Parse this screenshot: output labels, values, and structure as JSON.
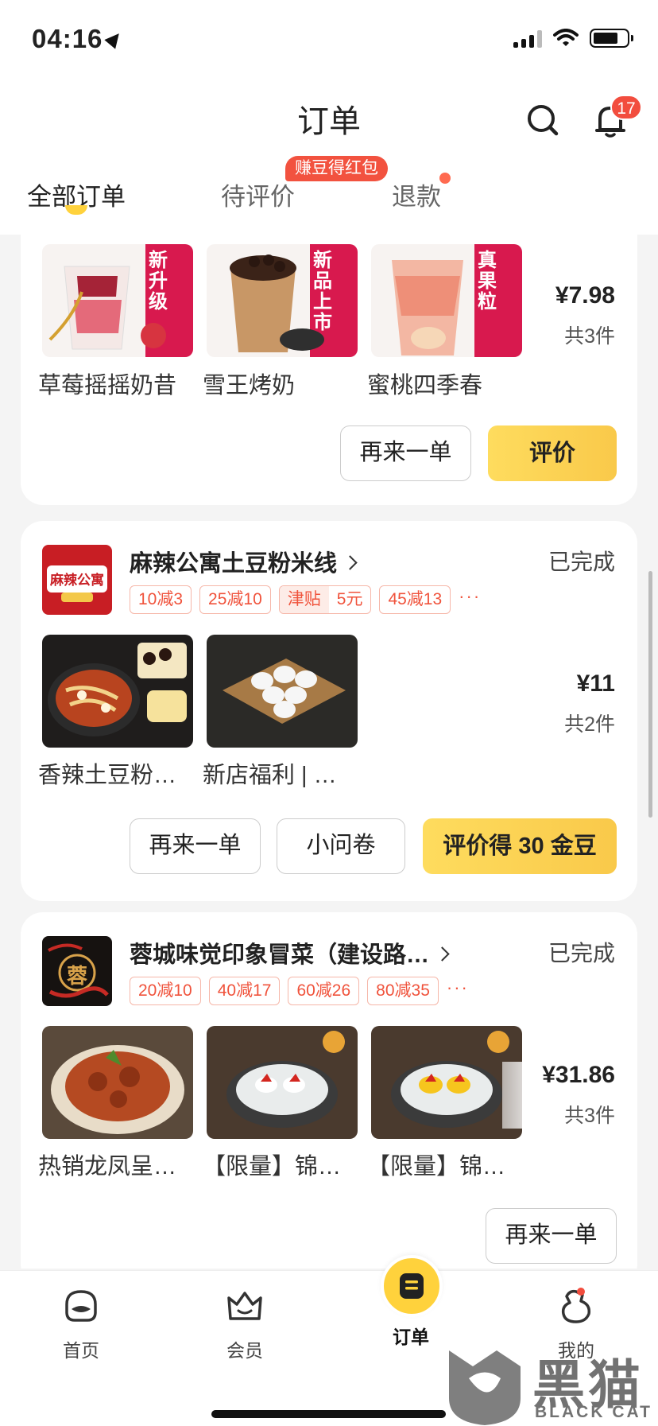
{
  "status_bar": {
    "time": "04:16"
  },
  "header": {
    "title": "订单",
    "notification_count": "17"
  },
  "tabs": [
    {
      "label": "全部订单",
      "active": true
    },
    {
      "label": "待评价",
      "active": false
    },
    {
      "label": "退款",
      "active": false
    }
  ],
  "tab_promo": "赚豆得红包",
  "orders": [
    {
      "items": [
        {
          "name": "草莓摇摇奶昔",
          "icon": "strawberry-milkshake",
          "badge": "新升级"
        },
        {
          "name": "雪王烤奶",
          "icon": "bubble-milk-tea",
          "badge": "新品上市"
        },
        {
          "name": "蜜桃四季春",
          "icon": "peach-tea",
          "badge": "真果粒"
        }
      ],
      "price": "¥7.98",
      "count": "共3件",
      "buttons": [
        "再来一单",
        "评价"
      ]
    },
    {
      "store": "麻辣公寓土豆粉米线",
      "logo_text": "麻辣公寓",
      "status": "已完成",
      "promos": [
        "10减3",
        "25减10"
      ],
      "subsidy": {
        "label": "津贴",
        "value": "5元"
      },
      "promos_after": [
        "45减13"
      ],
      "more": "···",
      "items": [
        {
          "name": "香辣土豆粉…",
          "icon": "spicy-noodle-pot"
        },
        {
          "name": "新店福利 | …",
          "icon": "quail-eggs"
        }
      ],
      "price": "¥11",
      "count": "共2件",
      "buttons": [
        "再来一单",
        "小问卷"
      ],
      "review_button": {
        "prefix": "评价得",
        "amount": "30",
        "suffix": "金豆"
      }
    },
    {
      "store": "蓉城味觉印象冒菜（建设路…",
      "logo_text": "蓉",
      "status": "已完成",
      "promos": [
        "20减10",
        "40减17",
        "60减26",
        "80减35"
      ],
      "more": "···",
      "items": [
        {
          "name": "热销龙凤呈…",
          "icon": "spicy-chicken-dish"
        },
        {
          "name": "【限量】锦…",
          "icon": "white-jelly-dessert"
        },
        {
          "name": "【限量】锦…",
          "icon": "yellow-jelly-dessert"
        }
      ],
      "price": "¥31.86",
      "count": "共3件",
      "buttons": [
        "再来一单"
      ]
    }
  ],
  "bottom_nav": [
    {
      "label": "首页",
      "icon": "home-icon"
    },
    {
      "label": "会员",
      "icon": "member-icon"
    },
    {
      "label": "订单",
      "icon": "orders-icon",
      "active": true
    },
    {
      "label": "我的",
      "icon": "profile-icon"
    }
  ],
  "watermark": {
    "text": "黑猫",
    "sub": "BLACK CAT"
  },
  "colors": {
    "accent": "#ffd23c",
    "promo_red": "#f0533c",
    "badge_red": "#f24d3e"
  }
}
